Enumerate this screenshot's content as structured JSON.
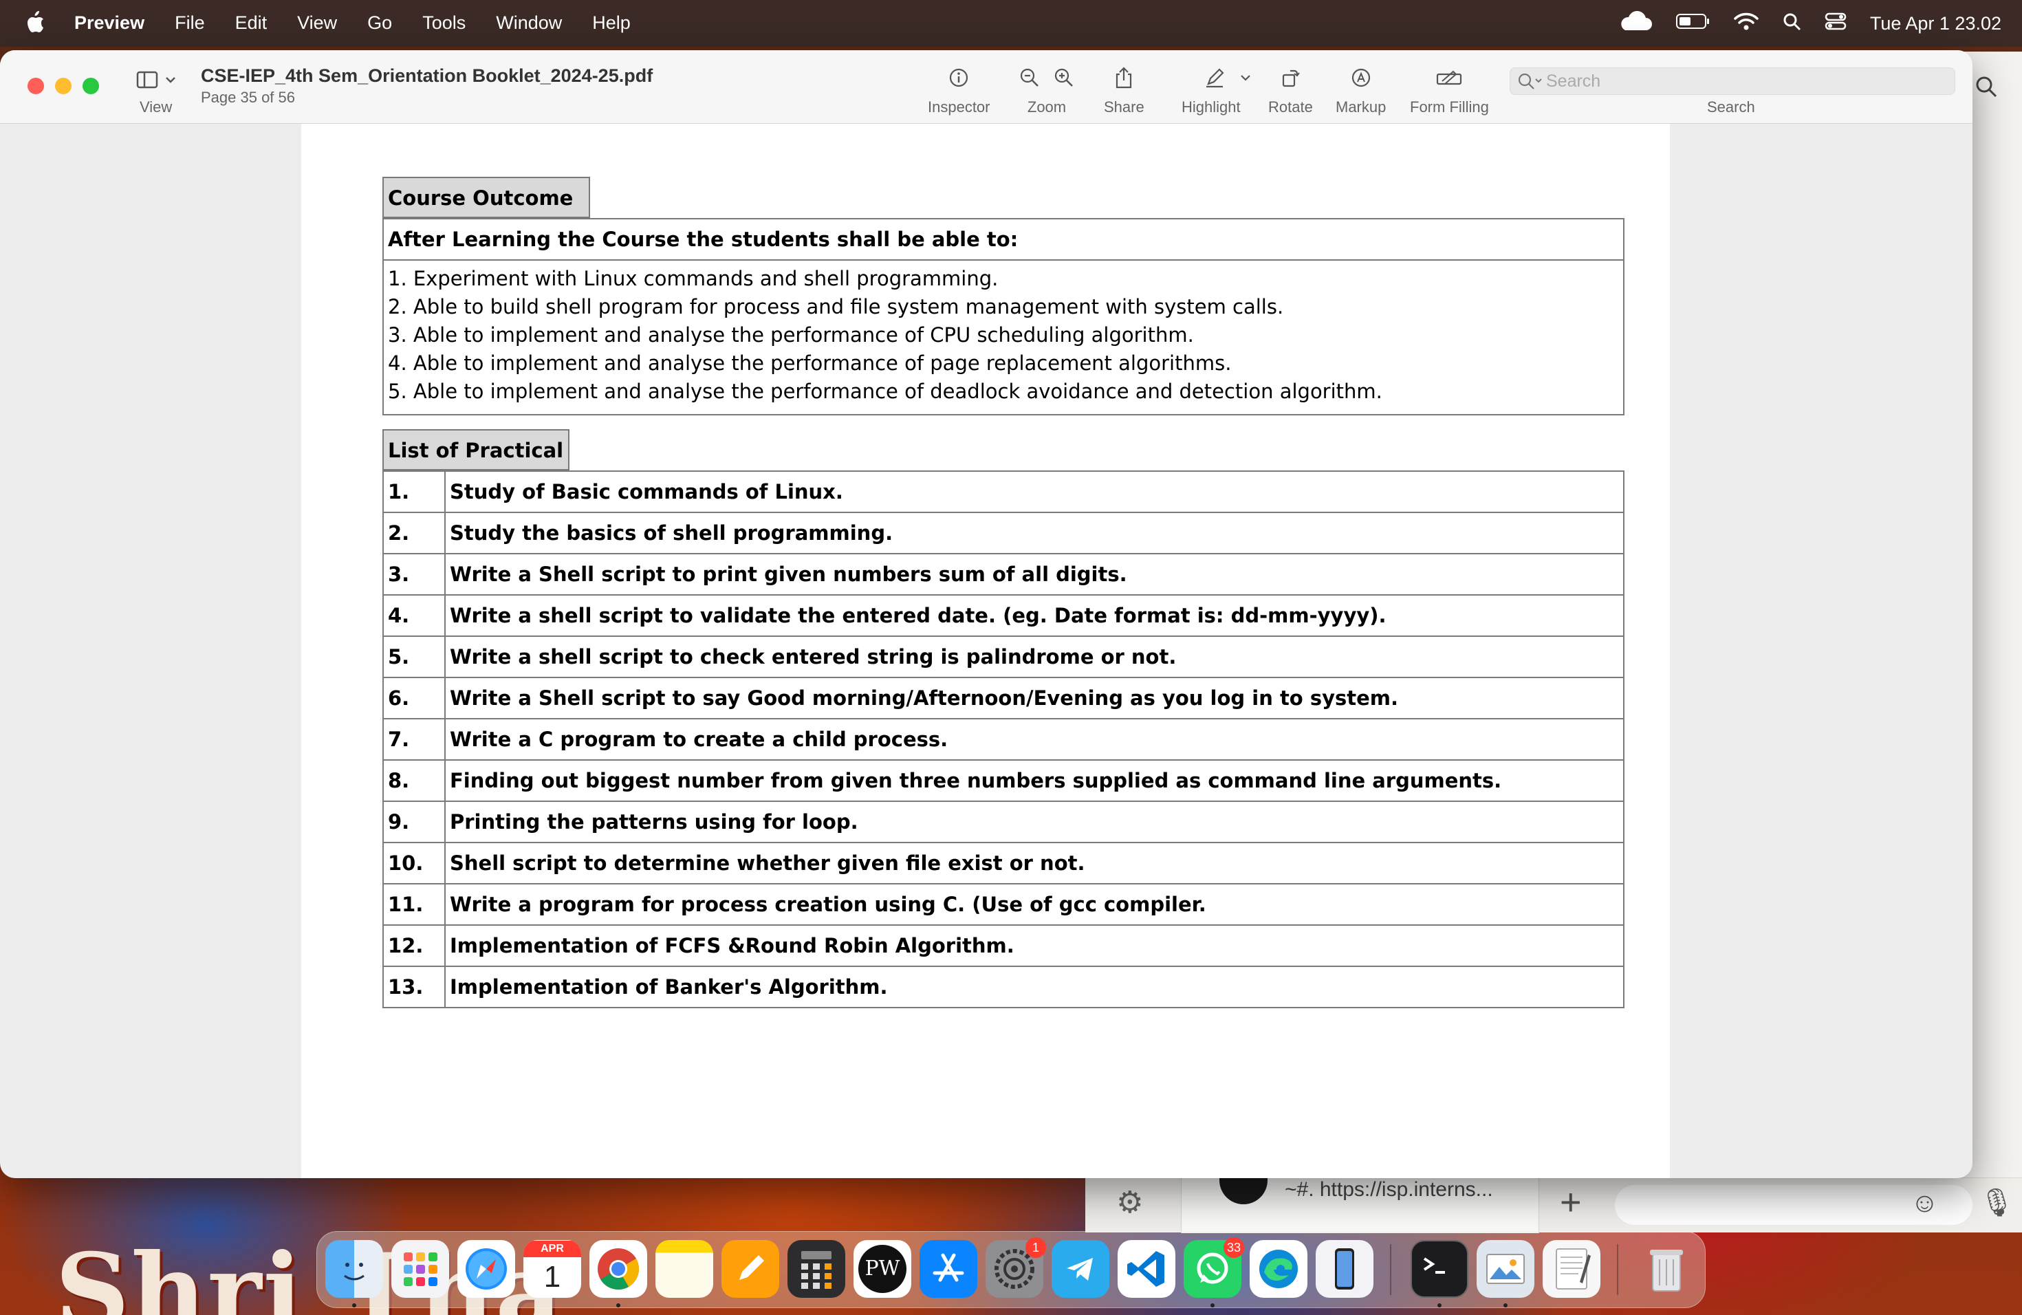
{
  "menubar": {
    "app_name": "Preview",
    "menus": [
      "File",
      "Edit",
      "View",
      "Go",
      "Tools",
      "Window",
      "Help"
    ],
    "clock": "Tue Apr 1  23.02"
  },
  "window": {
    "title": "CSE-IEP_4th Sem_Orientation Booklet_2024-25.pdf",
    "page_info": "Page 35 of 56",
    "view_label": "View",
    "toolbar": {
      "inspector": "Inspector",
      "zoom": "Zoom",
      "share": "Share",
      "highlight": "Highlight",
      "rotate": "Rotate",
      "markup": "Markup",
      "form_filling": "Form Filling",
      "search_label": "Search"
    },
    "search": {
      "placeholder": "Search"
    }
  },
  "document": {
    "course_outcome": {
      "title": "Course Outcome",
      "intro": "After Learning the Course the students shall be able to:",
      "items": [
        "1. Experiment with Linux commands and shell programming.",
        "2. Able to build shell program for process and file system management with system calls.",
        "3. Able to implement and analyse the performance of CPU scheduling algorithm.",
        "4. Able to implement and analyse the performance of page replacement algorithms.",
        "5. Able to implement and analyse the performance of deadlock avoidance and detection algorithm."
      ]
    },
    "practicals": {
      "title": "List of Practical",
      "rows": [
        {
          "num": "1.",
          "text": "Study of Basic commands of Linux."
        },
        {
          "num": "2.",
          "text": "Study the basics of shell programming."
        },
        {
          "num": "3.",
          "text": "Write a Shell script to print given numbers sum of all digits."
        },
        {
          "num": "4.",
          "text": "Write a shell script to validate the entered date. (eg. Date format is: dd-mm-yyyy)."
        },
        {
          "num": "5.",
          "text": "Write a shell script to check entered string is palindrome or not."
        },
        {
          "num": "6.",
          "text": "Write a Shell script to say Good morning/Afternoon/Evening as you log in to system."
        },
        {
          "num": "7.",
          "text": "Write a C program to create a child process."
        },
        {
          "num": "8.",
          "text": "Finding out biggest number from given three numbers supplied as command line arguments."
        },
        {
          "num": "9.",
          "text": "Printing the patterns using for loop."
        },
        {
          "num": "10.",
          "text": "Shell script to determine whether given file exist or not."
        },
        {
          "num": "11.",
          "text": "Write a program for process creation using C. (Use of gcc compiler."
        },
        {
          "num": "12.",
          "text": "Implementation of FCFS &Round Robin Algorithm."
        },
        {
          "num": "13.",
          "text": "Implementation of Banker's Algorithm."
        }
      ]
    }
  },
  "background_app": {
    "link_preview": "~#. https://isp.interns..."
  },
  "wallpaper": {
    "text": "Shri Tha"
  },
  "dock": {
    "calendar_month": "APR",
    "calendar_day": "1",
    "settings_badge": "1",
    "whatsapp_badge": "33",
    "pw_text": "PW"
  }
}
